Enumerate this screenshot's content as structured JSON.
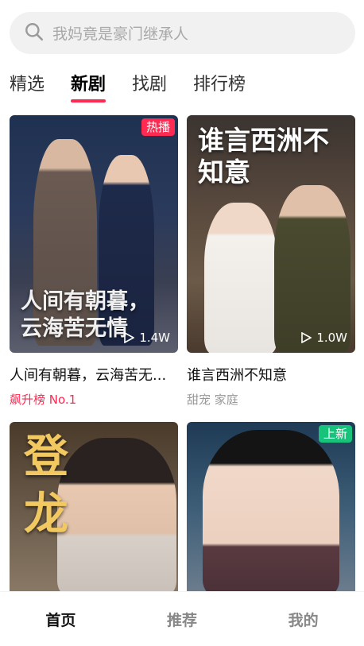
{
  "search": {
    "placeholder": "我妈竟是豪门继承人"
  },
  "tabs": [
    {
      "label": "精选",
      "active": false
    },
    {
      "label": "新剧",
      "active": true
    },
    {
      "label": "找剧",
      "active": false
    },
    {
      "label": "排行榜",
      "active": false
    }
  ],
  "cards": [
    {
      "title": "人间有朝暮，云海苦无...",
      "subtitle": "飙升榜 No.1",
      "badge": "热播",
      "plays": "1.4W",
      "poster_text": "人间有朝暮，云海苦无情"
    },
    {
      "title": "谁言西洲不知意",
      "subtitle": "甜宠 家庭",
      "badge": "",
      "plays": "1.0W",
      "poster_text": "谁言西洲不知意"
    },
    {
      "title": "",
      "subtitle": "",
      "badge": "",
      "plays": "",
      "poster_text": "登龙"
    },
    {
      "title": "",
      "subtitle": "",
      "badge": "上新",
      "plays": "",
      "poster_text": ""
    }
  ],
  "bottom_nav": [
    {
      "label": "首页",
      "active": true
    },
    {
      "label": "推荐",
      "active": false
    },
    {
      "label": "我的",
      "active": false
    }
  ],
  "colors": {
    "accent": "#ff2a52",
    "new_badge": "#17c37b",
    "search_bg": "#f1f1f1"
  }
}
